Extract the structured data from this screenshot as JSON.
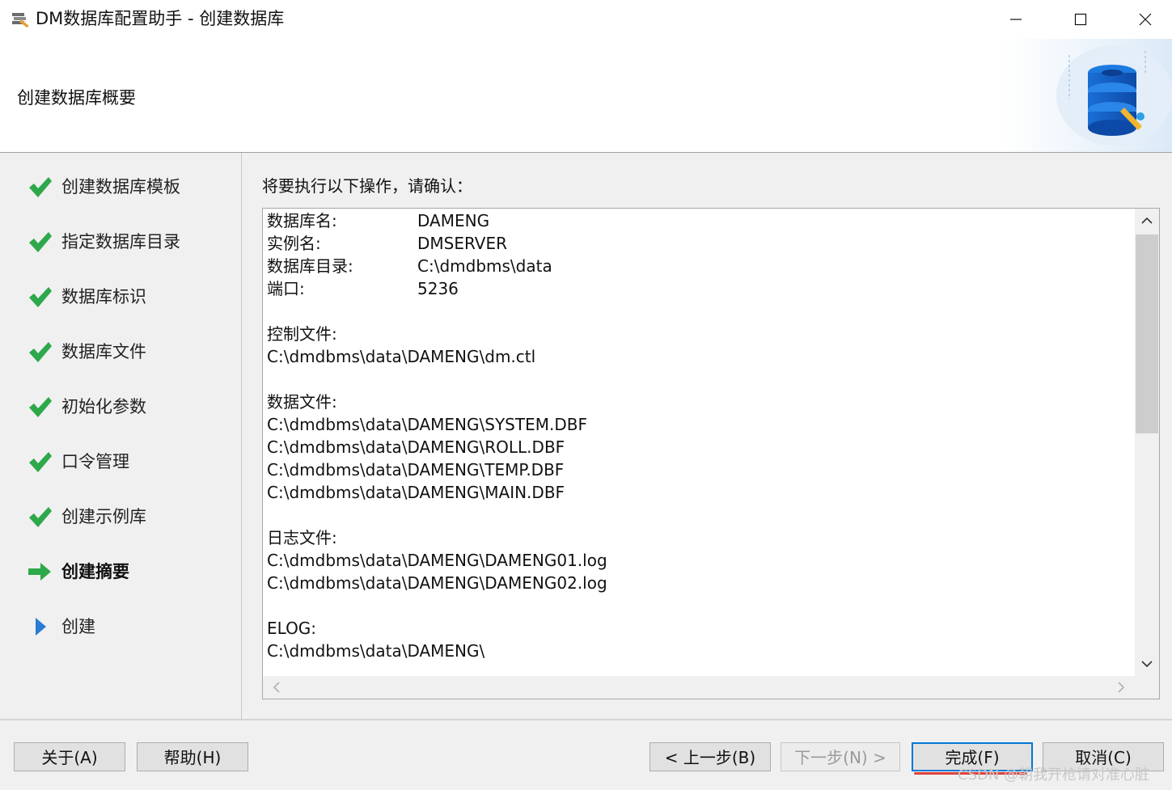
{
  "window": {
    "title": "DM数据库配置助手 - 创建数据库",
    "icons": [
      "app-icon",
      "minimize-icon",
      "maximize-icon",
      "close-icon"
    ]
  },
  "header": {
    "title": "创建数据库概要",
    "art_icon": "database-tools-icon"
  },
  "sidebar": {
    "steps": [
      {
        "label": "创建数据库模板",
        "status": "done",
        "icon": "check-icon"
      },
      {
        "label": "指定数据库目录",
        "status": "done",
        "icon": "check-icon"
      },
      {
        "label": "数据库标识",
        "status": "done",
        "icon": "check-icon"
      },
      {
        "label": "数据库文件",
        "status": "done",
        "icon": "check-icon"
      },
      {
        "label": "初始化参数",
        "status": "done",
        "icon": "check-icon"
      },
      {
        "label": "口令管理",
        "status": "done",
        "icon": "check-icon"
      },
      {
        "label": "创建示例库",
        "status": "done",
        "icon": "check-icon"
      },
      {
        "label": "创建摘要",
        "status": "current",
        "icon": "arrow-right-icon"
      },
      {
        "label": "创建",
        "status": "pending",
        "icon": "triangle-right-icon"
      }
    ]
  },
  "main": {
    "prompt": "将要执行以下操作，请确认：",
    "summary": {
      "db_name_label": "数据库名:",
      "db_name": "DAMENG",
      "instance_label": "实例名:",
      "instance": "DMSERVER",
      "dir_label": "数据库目录:",
      "dir": "C:\\dmdbms\\data",
      "port_label": "端口:",
      "port": "5236",
      "ctl_label": "控制文件:",
      "ctl_file": "C:\\dmdbms\\data\\DAMENG\\dm.ctl",
      "data_label": "数据文件:",
      "data_files": [
        "C:\\dmdbms\\data\\DAMENG\\SYSTEM.DBF",
        "C:\\dmdbms\\data\\DAMENG\\ROLL.DBF",
        "C:\\dmdbms\\data\\DAMENG\\TEMP.DBF",
        "C:\\dmdbms\\data\\DAMENG\\MAIN.DBF"
      ],
      "log_label": "日志文件:",
      "log_files": [
        "C:\\dmdbms\\data\\DAMENG\\DAMENG01.log",
        "C:\\dmdbms\\data\\DAMENG\\DAMENG02.log"
      ],
      "elog_label": "ELOG:",
      "elog": "C:\\dmdbms\\data\\DAMENG\\"
    }
  },
  "footer": {
    "about": "关于(A)",
    "help": "帮助(H)",
    "back": "< 上一步(B)",
    "next": "下一步(N) >",
    "finish": "完成(F)",
    "cancel": "取消(C)"
  },
  "watermark": "CSDN @朝我开枪请对准心脏",
  "colors": {
    "check": "#2da84a",
    "pending": "#2a7bd4",
    "accent": "#0078d7",
    "highlight": "#e0403a"
  }
}
